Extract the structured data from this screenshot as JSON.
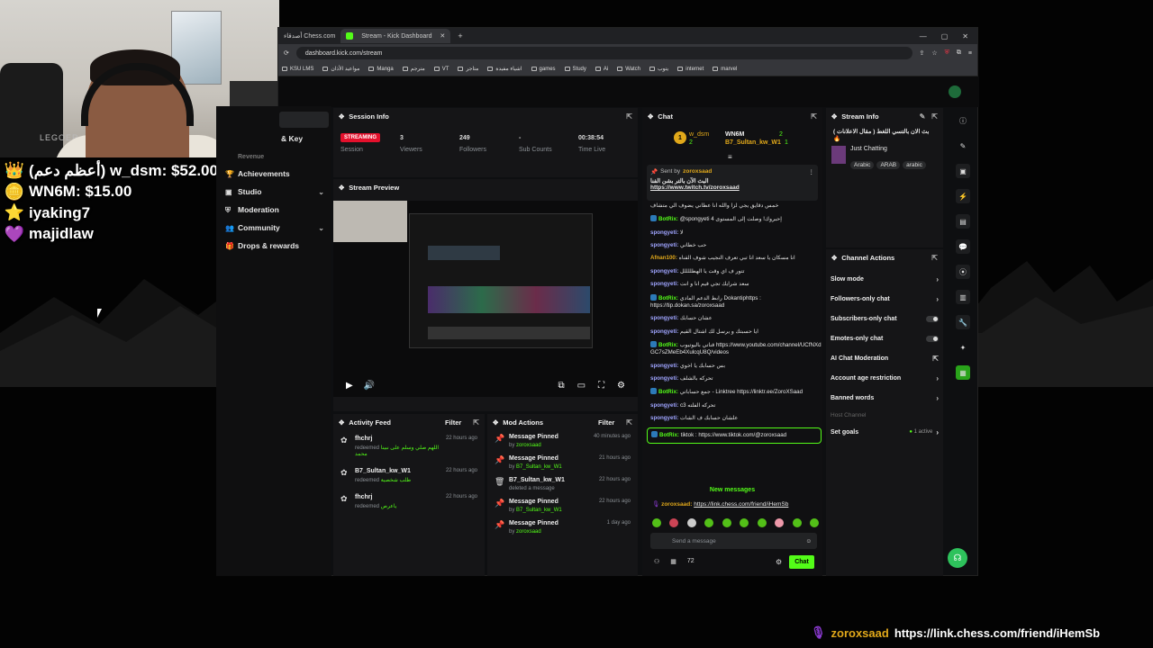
{
  "donors": [
    {
      "icon": "crown-icon",
      "glyph": "👑",
      "text": "(أعظم دعم) w_dsm: $52.00"
    },
    {
      "icon": "coin-icon",
      "glyph": "🪙",
      "text": "WN6M: $15.00"
    },
    {
      "icon": "star-icon",
      "glyph": "⭐",
      "text": "iyaking7"
    },
    {
      "icon": "heart-icon",
      "glyph": "💜",
      "text": "majidlaw"
    }
  ],
  "webcam": {
    "chair_brand": "LEGOER"
  },
  "browser": {
    "tabs": [
      {
        "label": "أصدقاء Chess.com"
      },
      {
        "label": "Stream - Kick Dashboard"
      }
    ],
    "url": "dashboard.kick.com/stream",
    "bookmarks": [
      "KSU LMS",
      "مواعيد الأذان",
      "Manga",
      "مترجم",
      "VT",
      "متاجر",
      "اشياء مفيدة",
      "games",
      "Study",
      "Ai",
      "Watch",
      "يتوب",
      "internet",
      "marvel"
    ]
  },
  "leftnav": {
    "items": [
      {
        "label": "& Key"
      },
      {
        "label": "Achievements"
      },
      {
        "label": "Studio"
      },
      {
        "label": "Moderation"
      },
      {
        "label": "Community"
      },
      {
        "label": "Drops & rewards"
      }
    ],
    "partial": "Revenue"
  },
  "session_info": {
    "title": "Session Info",
    "status": "STREAMING",
    "status_label": "Session",
    "stats": [
      {
        "value": "3",
        "label": "Viewers"
      },
      {
        "value": "249",
        "label": "Followers"
      },
      {
        "value": "-",
        "label": "Sub Counts"
      },
      {
        "value": "00:38:54",
        "label": "Time Live"
      }
    ]
  },
  "stream_preview": {
    "title": "Stream Preview"
  },
  "activity_feed": {
    "title": "Activity Feed",
    "filter": "Filter",
    "items": [
      {
        "name": "fhchrj",
        "action": "redeemed",
        "detail": "اللهم صلي وسلم على نبينا محمد",
        "time": "22 hours ago"
      },
      {
        "name": "B7_Sultan_kw_W1",
        "action": "redeemed",
        "detail": "طلب شخصية",
        "time": "22 hours ago"
      },
      {
        "name": "fhchrj",
        "action": "redeemed",
        "detail": "ياعرص",
        "time": "22 hours ago"
      }
    ]
  },
  "mod_actions": {
    "title": "Mod Actions",
    "filter": "Filter",
    "items": [
      {
        "title": "Message Pinned",
        "by": "by",
        "user": "zoroxsaad",
        "time": "40 minutes ago"
      },
      {
        "title": "Message Pinned",
        "by": "by",
        "user": "B7_Sultan_kw_W1",
        "time": "21 hours ago"
      },
      {
        "title": "B7_Sultan_kw_W1",
        "by": "deleted a message",
        "user": "",
        "time": "22 hours ago"
      },
      {
        "title": "Message Pinned",
        "by": "by",
        "user": "B7_Sultan_kw_W1",
        "time": "22 hours ago"
      },
      {
        "title": "Message Pinned",
        "by": "by",
        "user": "zoroxsaad",
        "time": "1 day ago"
      }
    ]
  },
  "chat": {
    "title": "Chat",
    "leaderboard": [
      {
        "name": "w_dsm",
        "amount": "2"
      },
      {
        "name": "WN6M",
        "amount": "2"
      },
      {
        "name": "B7_Sultan_kw_W1",
        "amount": "1"
      }
    ],
    "pinned": {
      "sent_by": "Sent by",
      "user": "zoroxsaad",
      "text": "البث الآن بالتر بشن الفنا",
      "link": "https://www.twitch.tv/zoroxsaad"
    },
    "messages": [
      {
        "user": "",
        "text": "خمس دقايق يجي لزا والله انا عطاني يضوف الي متشاف",
        "bot": false
      },
      {
        "user": "BotRix:",
        "text": "@spongyeti إحبروك! وصلت إلى المستوى 4",
        "bot": true
      },
      {
        "user": "spongyeti:",
        "text": "لا",
        "bot": false
      },
      {
        "user": "spongyeti:",
        "text": "حب خطاني",
        "bot": false
      },
      {
        "user": "Afnan100:",
        "text": "انا مسكان يا سعد انا تبي تعرف النجيب شوف القناه",
        "bot": false
      },
      {
        "user": "spongyeti:",
        "text": "تتور ف اي وقت يا الهطللللل",
        "bot": false
      },
      {
        "user": "spongyeti:",
        "text": "سعد شرايك تجي قيم انا و انت",
        "bot": false
      },
      {
        "user": "BotRix:",
        "text": "رابط الدعم المادي Dokantiphttps : https://tip.dokan.sa/zoroxsaad",
        "bot": true
      },
      {
        "user": "spongyeti:",
        "text": "عشان حسابك",
        "bot": false
      },
      {
        "user": "spongyeti:",
        "text": "ايا حسبتك و يرسل لك اشتال القيم",
        "bot": false
      },
      {
        "user": "BotRix:",
        "text": "قناتي باليوتيوب https://www.youtube.com/channel/UCfNXdGC7sZMeEb4XulcqU8Q/videos",
        "bot": true
      },
      {
        "user": "spongyeti:",
        "text": "بس حسابك يا اخوي",
        "bot": false
      },
      {
        "user": "spongyeti:",
        "text": "تحركه بالشلف",
        "bot": false
      },
      {
        "user": "BotRix:",
        "text": "جمع حساباتي - Linktree https://linktr.ee/ZoroXSaad",
        "bot": true
      },
      {
        "user": "spongyeti:",
        "text": "c3 تحركه الفلته",
        "bot": false
      },
      {
        "user": "spongyeti:",
        "text": "علشان حسابك ف الشات",
        "bot": false
      },
      {
        "user": "BotRix:",
        "text": "tiktok : https://www.tiktok.com/@zoroxsaad",
        "bot": true
      }
    ],
    "new_messages": "New messages",
    "last": {
      "user": "zoroxsaad:",
      "link": "https://link.chess.com/friend/iHemSb"
    },
    "input_placeholder": "Send a message",
    "points": "72",
    "send_label": "Chat"
  },
  "stream_info": {
    "title": "Stream Info",
    "stream_title": "بث الان بالتسي اللغط ( مقال الاعلانات ) 🔥",
    "category": "Just Chatting",
    "tags": [
      "Arabic",
      "ARAB",
      "arabic"
    ]
  },
  "channel_actions": {
    "title": "Channel Actions",
    "items": [
      {
        "label": "Slow mode",
        "type": "arrow"
      },
      {
        "label": "Followers-only chat",
        "type": "arrow"
      },
      {
        "label": "Subscribers-only chat",
        "type": "toggle"
      },
      {
        "label": "Emotes-only chat",
        "type": "toggle"
      },
      {
        "label": "AI Chat Moderation",
        "type": "link"
      },
      {
        "label": "Account age restriction",
        "type": "arrow"
      },
      {
        "label": "Banned words",
        "type": "arrow"
      }
    ],
    "host_channel": "Host Channel",
    "goals": {
      "label": "Set goals",
      "status": "1 active"
    }
  },
  "overlay_bottom": {
    "user": "zoroxsaad",
    "link": "https://link.chess.com/friend/iHemSb"
  },
  "colors": {
    "accent": "#53fc18",
    "live": "#e4102c",
    "bg": "#0e0f11"
  }
}
